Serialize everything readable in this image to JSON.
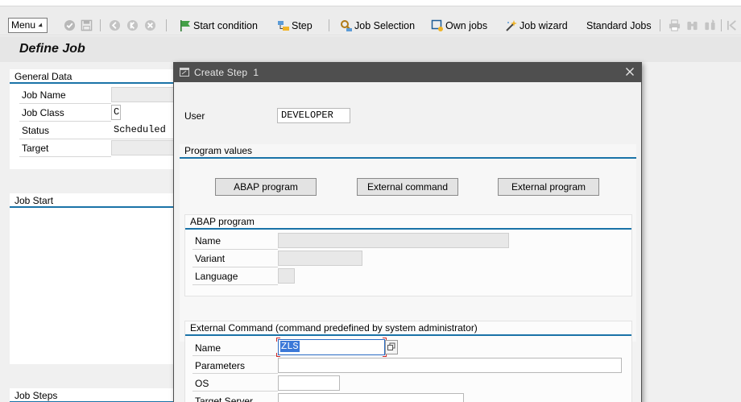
{
  "toolbar": {
    "menu_label": "Menu",
    "start_condition": "Start condition",
    "step": "Step",
    "job_selection": "Job Selection",
    "own_jobs": "Own jobs",
    "job_wizard": "Job wizard",
    "standard_jobs": "Standard Jobs"
  },
  "page": {
    "title": "Define Job"
  },
  "general_data": {
    "header": "General Data",
    "job_name_label": "Job Name",
    "job_name_value": "",
    "job_class_label": "Job Class",
    "job_class_value": "C",
    "status_label": "Status",
    "status_value": "Scheduled",
    "target_label": "Target",
    "target_value": ""
  },
  "job_start": {
    "header": "Job Start"
  },
  "job_steps": {
    "header": "Job Steps"
  },
  "dialog": {
    "title": "Create Step",
    "step_number": "1",
    "user_label": "User",
    "user_value": "DEVELOPER",
    "program_values_header": "Program values",
    "btn_abap": "ABAP program",
    "btn_external_command": "External command",
    "btn_external_program": "External program",
    "abap_section": {
      "header": "ABAP program",
      "name_label": "Name",
      "name_value": "",
      "variant_label": "Variant",
      "variant_value": "",
      "language_label": "Language",
      "language_value": ""
    },
    "ext_cmd_section": {
      "header": "External Command (command predefined by system administrator)",
      "name_label": "Name",
      "name_value": "ZLS",
      "parameters_label": "Parameters",
      "parameters_value": "",
      "os_label": "OS",
      "os_value": "",
      "target_server_label": "Target Server",
      "target_server_value": ""
    }
  },
  "colors": {
    "accent_blue": "#1a73a8",
    "dialog_title_bg": "#4f4f4f",
    "selection_blue": "#3b78d8"
  }
}
